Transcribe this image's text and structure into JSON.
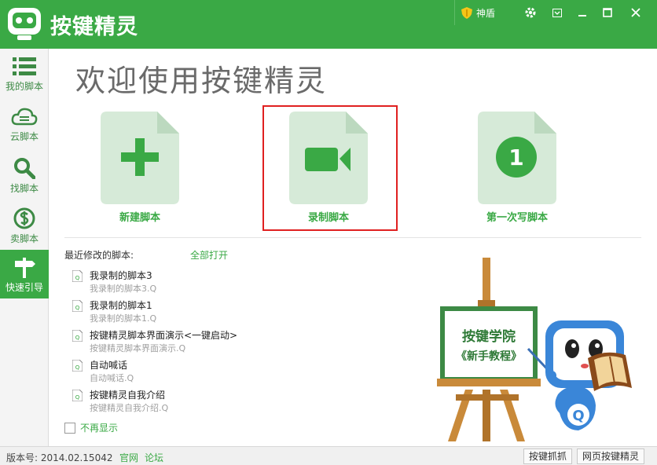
{
  "titlebar": {
    "app_title": "按键精灵",
    "shield_label": "神盾",
    "icons": [
      "gear-icon",
      "menu-icon",
      "minimize-icon",
      "maximize-icon",
      "close-icon"
    ]
  },
  "sidebar": {
    "items": [
      {
        "label": "我的脚本",
        "icon": "list-icon"
      },
      {
        "label": "云脚本",
        "icon": "cloud-icon"
      },
      {
        "label": "找脚本",
        "icon": "search-icon"
      },
      {
        "label": "卖脚本",
        "icon": "dollar-icon"
      },
      {
        "label": "快速引导",
        "icon": "signpost-icon",
        "active": true
      }
    ]
  },
  "main": {
    "welcome": "欢迎使用按键精灵",
    "cards": [
      {
        "label": "新建脚本",
        "icon": "plus-icon"
      },
      {
        "label": "录制脚本",
        "icon": "video-icon",
        "highlighted": true
      },
      {
        "label": "第一次写脚本",
        "icon": "number-one-icon",
        "badge": "1"
      }
    ],
    "recent": {
      "title": "最近修改的脚本:",
      "open_all": "全部打开",
      "items": [
        {
          "name": "我录制的脚本3",
          "file": "我录制的脚本3.Q"
        },
        {
          "name": "我录制的脚本1",
          "file": "我录制的脚本1.Q"
        },
        {
          "name": "按键精灵脚本界面演示<一键启动>",
          "file": "按键精灵脚本界面演示.Q"
        },
        {
          "name": "自动喊话",
          "file": "自动喊话.Q"
        },
        {
          "name": "按键精灵自我介绍",
          "file": "按键精灵自我介绍.Q"
        }
      ]
    },
    "no_show": "不再显示",
    "illustration": {
      "board_line1": "按键学院",
      "board_line2": "《新手教程》",
      "mascot_letter": "Q"
    }
  },
  "statusbar": {
    "version": "版本号: 2014.02.15042",
    "link_official": "官网",
    "link_forum": "论坛",
    "btn_capture": "按键抓抓",
    "btn_web": "网页按键精灵"
  },
  "colors": {
    "brand": "#3aa945",
    "highlight": "#e02020"
  }
}
